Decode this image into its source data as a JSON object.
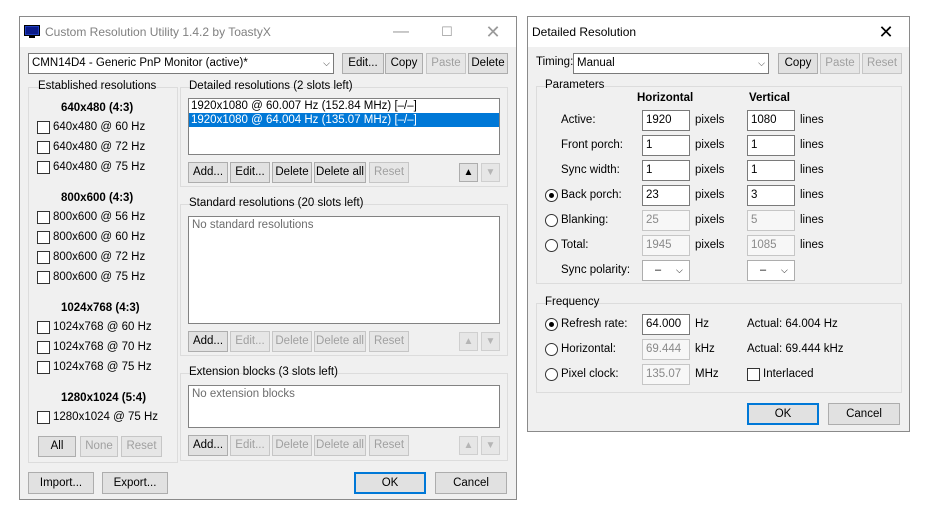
{
  "cru": {
    "title": "Custom Resolution Utility 1.4.2 by ToastyX",
    "monitor_select": "CMN14D4 - Generic PnP Monitor (active)*",
    "top_buttons": {
      "edit": "Edit...",
      "copy": "Copy",
      "paste": "Paste",
      "delete": "Delete"
    },
    "established": {
      "title": "Established resolutions",
      "groups": [
        {
          "heading": "640x480 (4:3)",
          "items": [
            "640x480 @ 60 Hz",
            "640x480 @ 72 Hz",
            "640x480 @ 75 Hz"
          ]
        },
        {
          "heading": "800x600 (4:3)",
          "items": [
            "800x600 @ 56 Hz",
            "800x600 @ 60 Hz",
            "800x600 @ 72 Hz",
            "800x600 @ 75 Hz"
          ]
        },
        {
          "heading": "1024x768 (4:3)",
          "items": [
            "1024x768 @ 60 Hz",
            "1024x768 @ 70 Hz",
            "1024x768 @ 75 Hz"
          ]
        },
        {
          "heading": "1280x1024 (5:4)",
          "items": [
            "1280x1024 @ 75 Hz"
          ]
        }
      ],
      "buttons": {
        "all": "All",
        "none": "None",
        "reset": "Reset"
      }
    },
    "detailed": {
      "title": "Detailed resolutions (2 slots left)",
      "items": [
        "1920x1080 @ 60.007 Hz (152.84 MHz) [–/–]",
        "1920x1080 @ 64.004 Hz (135.07 MHz) [–/–]"
      ]
    },
    "standard": {
      "title": "Standard resolutions (20 slots left)",
      "empty": "No standard resolutions"
    },
    "extension": {
      "title": "Extension blocks (3 slots left)",
      "empty": "No extension blocks"
    },
    "list_buttons": {
      "add": "Add...",
      "edit": "Edit...",
      "delete": "Delete",
      "delete_all": "Delete all",
      "reset": "Reset"
    },
    "bottom": {
      "import": "Import...",
      "export": "Export...",
      "ok": "OK",
      "cancel": "Cancel"
    }
  },
  "dr": {
    "title": "Detailed Resolution",
    "timing_label": "Timing:",
    "timing_value": "Manual",
    "buttons": {
      "copy": "Copy",
      "paste": "Paste",
      "reset": "Reset"
    },
    "parameters": {
      "title": "Parameters",
      "col_h": "Horizontal",
      "col_v": "Vertical",
      "rows": [
        {
          "label": "Active:",
          "h": "1920",
          "v": "1080"
        },
        {
          "label": "Front porch:",
          "h": "1",
          "v": "1"
        },
        {
          "label": "Sync width:",
          "h": "1",
          "v": "1"
        },
        {
          "label": "Back porch:",
          "h": "23",
          "v": "3"
        },
        {
          "label": "Blanking:",
          "h": "25",
          "v": "5"
        },
        {
          "label": "Total:",
          "h": "1945",
          "v": "1085"
        }
      ],
      "unit_h": "pixels",
      "unit_v": "lines",
      "sync_polarity_label": "Sync polarity:",
      "sync_h": "–",
      "sync_v": "–"
    },
    "frequency": {
      "title": "Frequency",
      "refresh_label": "Refresh rate:",
      "refresh_value": "64.000",
      "refresh_unit": "Hz",
      "refresh_actual": "Actual: 64.004 Hz",
      "horizontal_label": "Horizontal:",
      "horizontal_value": "69.444",
      "horizontal_unit": "kHz",
      "horizontal_actual": "Actual: 69.444 kHz",
      "pixel_label": "Pixel clock:",
      "pixel_value": "135.07",
      "pixel_unit": "MHz",
      "interlaced_label": "Interlaced"
    },
    "ok": "OK",
    "cancel": "Cancel"
  }
}
